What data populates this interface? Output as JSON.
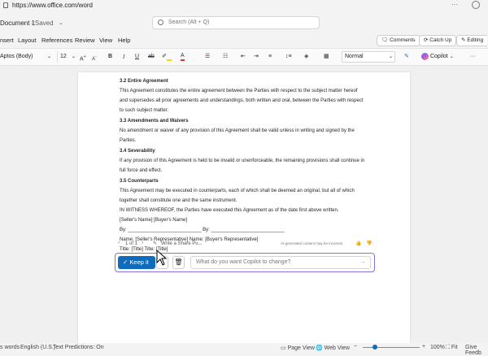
{
  "browser": {
    "url": "https://www.office.com/word"
  },
  "titlebar": {
    "doc_title": "Document 1",
    "saved": "Saved",
    "search_placeholder": "Search (Alt + Q)"
  },
  "menu": {
    "items": [
      "nsert",
      "Layout",
      "References",
      "Review",
      "View",
      "Help"
    ],
    "comments": "Comments",
    "catchup": "Catch Up",
    "editing": "Editing"
  },
  "ribbon": {
    "font": "Aptos (Body)",
    "size": "12",
    "style": "Normal",
    "copilot": "Copilot",
    "icons": [
      "increase-font",
      "decrease-font",
      "bold",
      "italic",
      "underline",
      "strikethrough",
      "highlight",
      "font-color",
      "bullets",
      "numbering",
      "indent",
      "outdent",
      "align",
      "line-spacing",
      "shading",
      "borders",
      "pen",
      "copilot"
    ]
  },
  "document": {
    "lines": [
      {
        "text": "3.2 Entire Agreement",
        "bold": true
      },
      {
        "text": "This Agreement constitutes the entire agreement between the Parties with respect to the subject matter hereof"
      },
      {
        "text": "and supersedes all prior agreements and understandings, both written and oral, between the Parties with respect"
      },
      {
        "text": "to such subject matter."
      },
      {
        "text": "3.3 Amendments and Waivers",
        "bold": true
      },
      {
        "text": "No amendment or waiver of any provision of this Agreement shall be valid unless in writing and signed by the"
      },
      {
        "text": "Parties."
      },
      {
        "text": "3.4 Severability",
        "bold": true
      },
      {
        "text": "If any provision of this Agreement is held to be invalid or unenforceable, the remaining provisions shall continue in"
      },
      {
        "text": "full force and effect."
      },
      {
        "text": "3.5 Counterparts",
        "bold": true
      },
      {
        "text": "This Agreement may be executed in counterparts, each of which shall be deemed an original, but all of which"
      },
      {
        "text": "together shall constitute one and the same instrument."
      },
      {
        "text": "IN WITNESS WHEREOF, the Parties have executed this Agreement as of the date first above written."
      },
      {
        "text": "[Seller's Name] [Buyer's Name]"
      },
      {
        "text": "By: ___________________________ By: ___________________________"
      },
      {
        "text": "Name: [Seller's Representative] Name: [Buyer's Representative]"
      },
      {
        "text": "Title: [Title] Title: [Title]"
      }
    ]
  },
  "copilot": {
    "pager": "1 of 1",
    "write_share": "Write a Share Pu...",
    "ai_note": "AI-generated content may be incorrect",
    "keep": "Keep it",
    "input_placeholder": "What do you want Copilot to change?"
  },
  "status": {
    "words": "s words",
    "language": "English (U.S.)",
    "predictions": "Text Predictions: On",
    "page_view": "Page View",
    "web_view": "Web View",
    "zoom": "100%",
    "fit": "Fit",
    "feedback": "Give Feedb"
  },
  "colors": {
    "accent": "#0f6cbd",
    "copilot_border": "#8a6fe0"
  }
}
